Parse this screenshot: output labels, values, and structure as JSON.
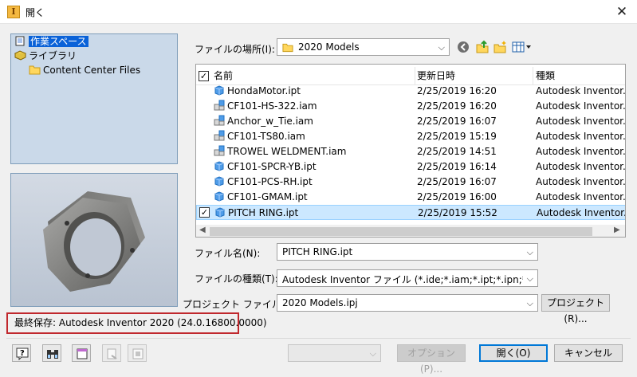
{
  "window": {
    "title": "開く",
    "close_glyph": "✕"
  },
  "workspace": {
    "items": [
      {
        "label": "作業スペース",
        "icon": "workspace-icon",
        "selected": true
      },
      {
        "label": "ライブラリ",
        "icon": "library-icon",
        "selected": false
      },
      {
        "label": "Content Center Files",
        "icon": "folder-icon",
        "selected": false
      }
    ]
  },
  "location": {
    "label": "ファイルの場所(I):",
    "value": "2020 Models"
  },
  "filelist": {
    "columns": [
      "名前",
      "更新日時",
      "種類"
    ],
    "rows": [
      {
        "name": "HondaMotor.ipt",
        "date": "2/25/2019 16:20",
        "type": "Autodesk Inventor...",
        "icon": "part-icon"
      },
      {
        "name": "CF101-HS-322.iam",
        "date": "2/25/2019 16:20",
        "type": "Autodesk Inventor...",
        "icon": "assembly-icon"
      },
      {
        "name": "Anchor_w_Tie.iam",
        "date": "2/25/2019 16:07",
        "type": "Autodesk Inventor...",
        "icon": "assembly-icon"
      },
      {
        "name": "CF101-TS80.iam",
        "date": "2/25/2019 15:19",
        "type": "Autodesk Inventor...",
        "icon": "assembly-icon"
      },
      {
        "name": "TROWEL WELDMENT.iam",
        "date": "2/25/2019 14:51",
        "type": "Autodesk Inventor...",
        "icon": "assembly-icon"
      },
      {
        "name": "CF101-SPCR-YB.ipt",
        "date": "2/25/2019 16:14",
        "type": "Autodesk Inventor...",
        "icon": "part-icon"
      },
      {
        "name": "CF101-PCS-RH.ipt",
        "date": "2/25/2019 16:07",
        "type": "Autodesk Inventor...",
        "icon": "part-icon"
      },
      {
        "name": "CF101-GMAM.ipt",
        "date": "2/25/2019 16:00",
        "type": "Autodesk Inventor...",
        "icon": "part-icon"
      },
      {
        "name": "PITCH RING.ipt",
        "date": "2/25/2019 15:52",
        "type": "Autodesk Inventor...",
        "icon": "part-icon",
        "selected": true
      }
    ]
  },
  "filename": {
    "label": "ファイル名(N):",
    "value": "PITCH RING.ipt"
  },
  "filetype": {
    "label": "ファイルの種類(T):",
    "value": "Autodesk Inventor ファイル (*.ide;*.iam;*.ipt;*.ipn;*.dwg;*.id"
  },
  "project": {
    "label": "プロジェクト ファイル(J):",
    "value": "2020 Models.ipj",
    "button": "プロジェクト(R)..."
  },
  "status": {
    "text": "最終保存: Autodesk Inventor 2020 (24.0.16800.0000)"
  },
  "buttons": {
    "options": "オプション(P)...",
    "open": "開く(O)",
    "cancel": "キャンセル"
  }
}
